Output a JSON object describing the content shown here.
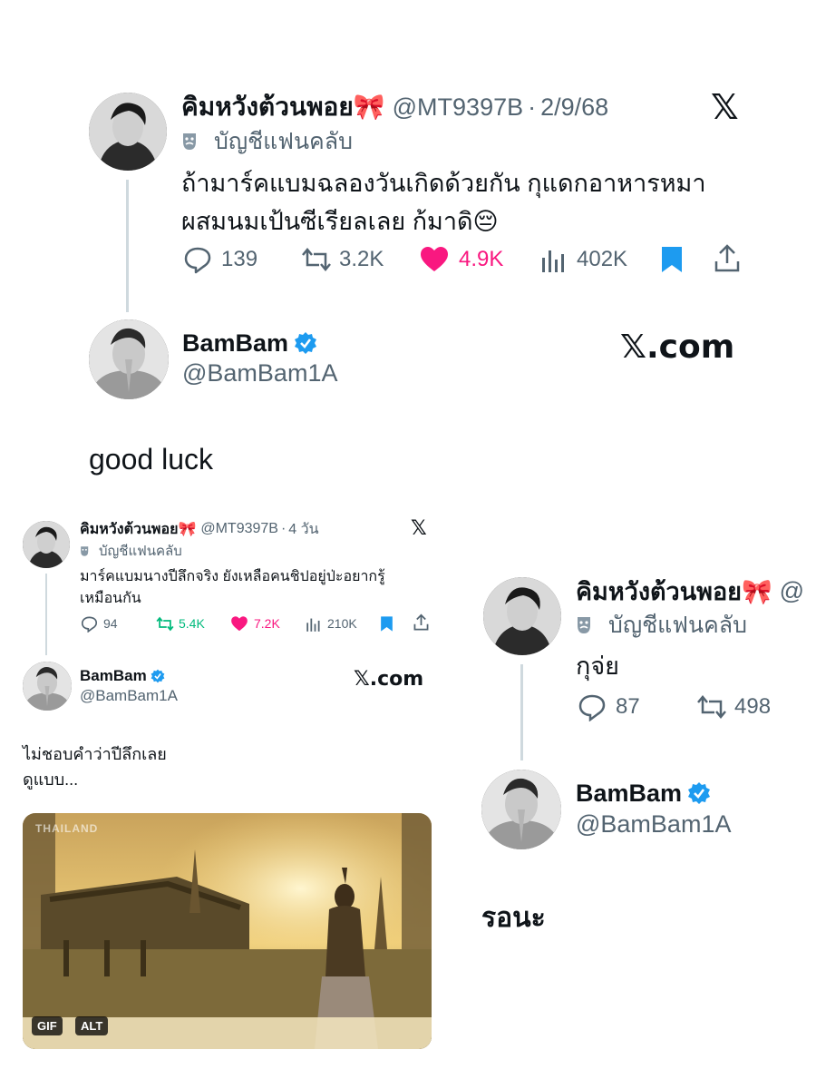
{
  "big_post": {
    "name": "คิมหวังต้วนพอย🎀",
    "handle": "@MT9397B",
    "sep": "·",
    "date": "2/9/68",
    "label": "บัญชีแฟนคลับ",
    "text_line1": "ถ้ามาร์คแบมฉลองวันเกิดด้วยกัน กุแดกอาหารหมา",
    "text_line2": "ผสมนมเป้นซีเรียลเลย ก้มาดิ😔",
    "replies": "139",
    "reposts": "3.2K",
    "likes": "4.9K",
    "views": "402K"
  },
  "big_reply": {
    "name": "BamBam",
    "handle": "@BamBam1A",
    "brand": "𝕏.com",
    "text": "good luck"
  },
  "small_post": {
    "name": "คิมหวังต้วนพอย🎀",
    "handle": "@MT9397B",
    "sep": "·",
    "date": "4 วัน",
    "label": "บัญชีแฟนคลับ",
    "text_line1": "มาร์คแบมนางปีลึกจริง ยังเหลือคนชิปอยู่ป่ะอยากรู้",
    "text_line2": "เหมือนกัน",
    "replies": "94",
    "reposts": "5.4K",
    "likes": "7.2K",
    "views": "210K"
  },
  "small_reply": {
    "name": "BamBam",
    "handle": "@BamBam1A",
    "brand": "𝕏.com",
    "text_line1": "ไม่ชอบคำว่าปีลึกเลย",
    "text_line2": "ดูแบบ...",
    "gif_watermark": "THAILAND",
    "badge_gif": "GIF",
    "badge_alt": "ALT"
  },
  "right_post": {
    "name": "คิมหวังต้วนพอย🎀",
    "handle_partial": "@",
    "label": "บัญชีแฟนคลับ",
    "text": "กุจ่ย",
    "replies": "87",
    "reposts": "498"
  },
  "right_reply": {
    "name": "BamBam",
    "handle": "@BamBam1A",
    "text": "รอนะ"
  },
  "colors": {
    "like_pink": "#f91880",
    "repost_green": "#00ba7c",
    "bookmark_blue": "#1d9bf0",
    "verified_blue": "#1d9bf0",
    "muted_gray": "#536471"
  }
}
